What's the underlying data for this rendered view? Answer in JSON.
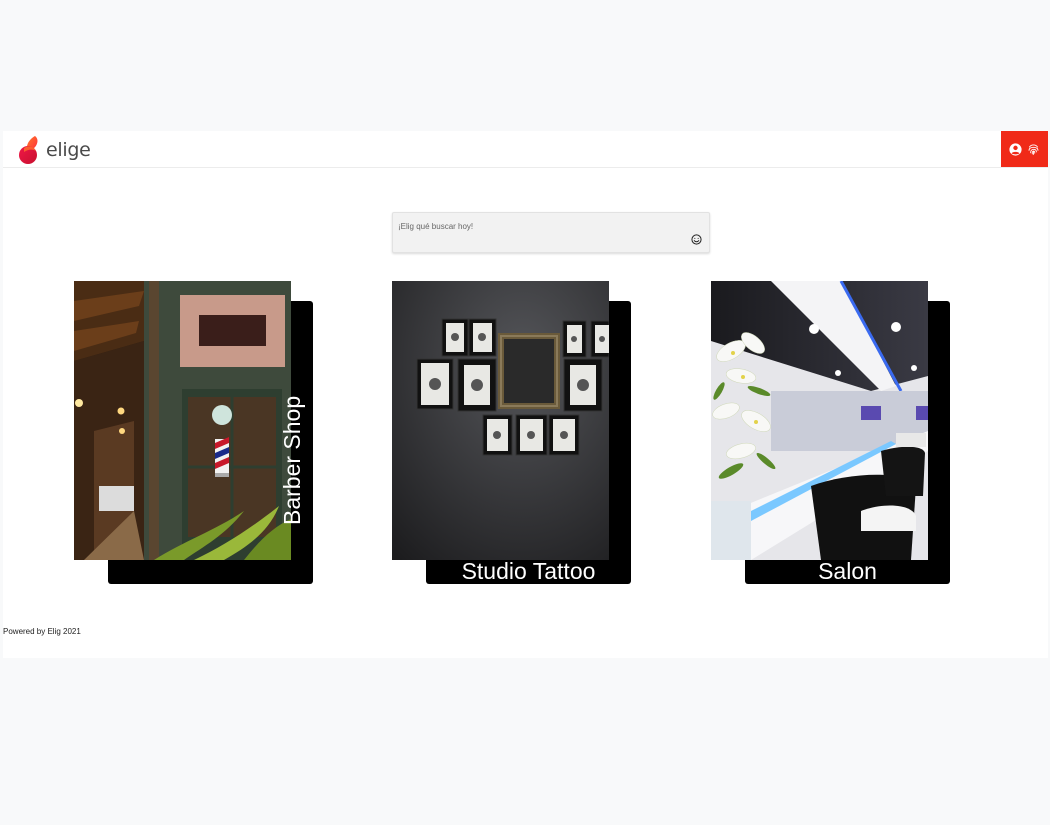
{
  "brand": {
    "name": "elige",
    "accent": "#f02a18"
  },
  "nav": {
    "icons": [
      "user-circle-icon",
      "fingerprint-icon"
    ],
    "background": "#f02a18"
  },
  "search": {
    "placeholder": "¡Elig qué buscar hoy!",
    "value": "",
    "icon": "smiley-icon"
  },
  "categories": [
    {
      "label": "Barber Shop",
      "label_orientation": "vertical"
    },
    {
      "label": "Studio Tattoo",
      "label_orientation": "horizontal"
    },
    {
      "label": "Salon",
      "label_orientation": "horizontal"
    }
  ],
  "footer": {
    "text": "Powered by Elig 2021"
  }
}
